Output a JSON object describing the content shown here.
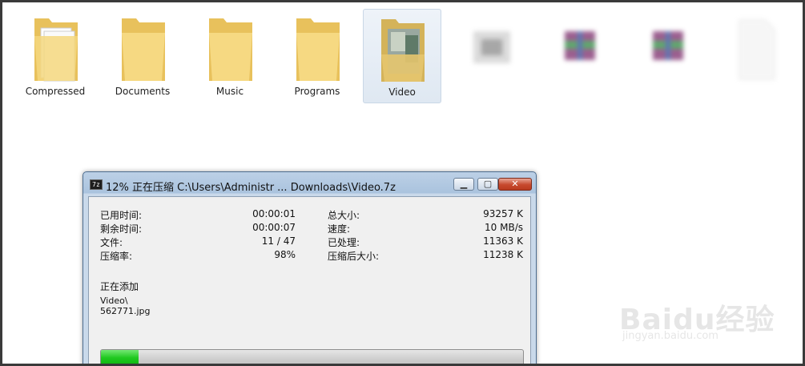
{
  "explorer": {
    "items": [
      {
        "label": "Compressed",
        "icon": "folder-zip-icon"
      },
      {
        "label": "Documents",
        "icon": "folder-icon"
      },
      {
        "label": "Music",
        "icon": "folder-icon"
      },
      {
        "label": "Programs",
        "icon": "folder-icon"
      },
      {
        "label": "Video",
        "icon": "folder-video-icon",
        "selected": true
      }
    ]
  },
  "dialog": {
    "app_icon": "7z",
    "title": "12% 正在压缩 C:\\Users\\Administr ... Downloads\\Video.7z",
    "buttons": {
      "minimize": "▁",
      "maximize": "▢",
      "close": "✕"
    },
    "stats_left": [
      {
        "label": "已用时间:",
        "value": "00:00:01"
      },
      {
        "label": "剩余时间:",
        "value": "00:00:07"
      },
      {
        "label": "文件:",
        "value": "11 / 47"
      },
      {
        "label": "压缩率:",
        "value": "98%"
      }
    ],
    "stats_right": [
      {
        "label": "总大小:",
        "value": "93257 K"
      },
      {
        "label": "速度:",
        "value": "10 MB/s"
      },
      {
        "label": "已处理:",
        "value": "11363 K"
      },
      {
        "label": "压缩后大小:",
        "value": "11238 K"
      }
    ],
    "status_label": "正在添加",
    "current_path_line1": "Video\\",
    "current_path_line2": "562771.jpg",
    "progress_fraction": 0.09
  },
  "watermark": {
    "text": "Baidu经验",
    "sub": "jingyan.baidu.com"
  },
  "colors": {
    "progress_green": "#1fc81f",
    "close_red": "#c7492d"
  }
}
